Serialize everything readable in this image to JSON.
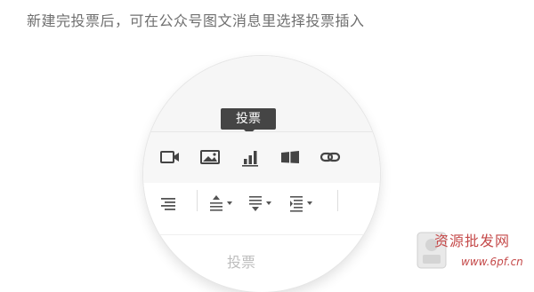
{
  "caption": "新建完投票后，可在公众号图文消息里选择投票插入",
  "tooltip": "投票",
  "toolbar_top": {
    "items": [
      {
        "name": "video-icon",
        "label": "video"
      },
      {
        "name": "image-icon",
        "label": "image"
      },
      {
        "name": "poll-icon",
        "label": "poll"
      },
      {
        "name": "card-icon",
        "label": "card"
      },
      {
        "name": "link-icon",
        "label": "link"
      }
    ]
  },
  "toolbar_bottom": {
    "items": [
      {
        "name": "align-right-icon"
      },
      {
        "name": "spacing-before-dropdown"
      },
      {
        "name": "spacing-after-dropdown"
      },
      {
        "name": "line-height-dropdown"
      }
    ]
  },
  "partial_text": "投票",
  "watermark": {
    "text": "资源批发网",
    "url": "www.6pf.cn"
  },
  "colors": {
    "tooltip_bg": "#454545",
    "icon": "#444444",
    "watermark": "#c54a4a"
  }
}
